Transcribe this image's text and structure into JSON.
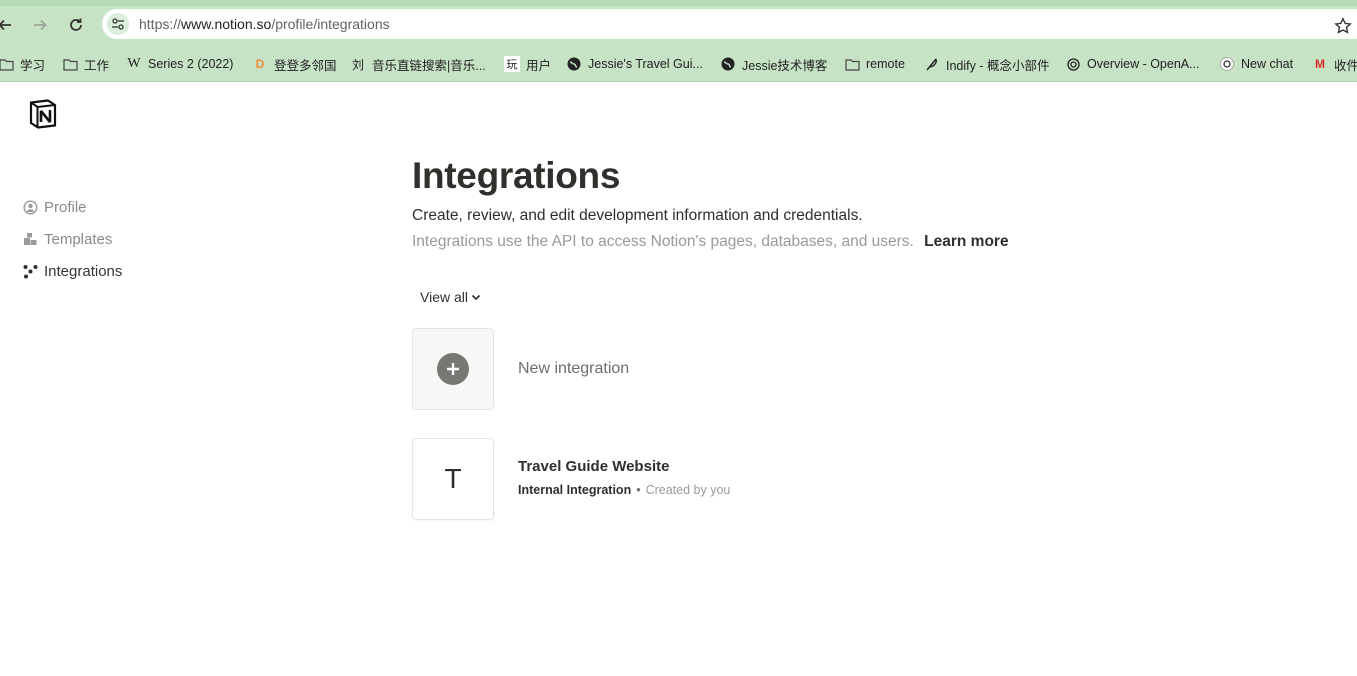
{
  "browser": {
    "url_prefix": "https://",
    "url_host": "www.notion.so",
    "url_path": "/profile/integrations",
    "bookmarks": [
      {
        "label": "学习",
        "icon": "folder-icon"
      },
      {
        "label": "工作",
        "icon": "folder-icon"
      },
      {
        "label": "Series 2 (2022)",
        "icon": "wikipedia-icon",
        "glyph": "W"
      },
      {
        "label": "登登多邻国",
        "icon": "duolingo-icon",
        "glyph": "D"
      },
      {
        "label": "音乐直链搜索|音乐...",
        "icon": "music-search-icon",
        "glyph": "刘"
      },
      {
        "label": "用户",
        "icon": "user-site-icon",
        "glyph": "玩"
      },
      {
        "label": "Jessie's Travel Gui...",
        "icon": "globe-icon"
      },
      {
        "label": "Jessie技术博客",
        "icon": "globe-icon"
      },
      {
        "label": "remote",
        "icon": "folder-icon"
      },
      {
        "label": "Indify - 概念小部件",
        "icon": "feather-icon"
      },
      {
        "label": "Overview - OpenA...",
        "icon": "openai-icon"
      },
      {
        "label": "New chat",
        "icon": "chatgpt-icon"
      },
      {
        "label": "收件",
        "icon": "gmail-icon",
        "glyph": "M"
      }
    ]
  },
  "sidebar": {
    "items": [
      {
        "label": "Profile",
        "icon": "profile-icon",
        "active": false
      },
      {
        "label": "Templates",
        "icon": "templates-icon",
        "active": false
      },
      {
        "label": "Integrations",
        "icon": "integrations-icon",
        "active": true
      }
    ]
  },
  "main": {
    "title": "Integrations",
    "subtitle": "Create, review, and edit development information and credentials.",
    "description": "Integrations use the API to access Notion's pages, databases, and users.",
    "learn_more": "Learn more",
    "filter_label": "View all",
    "new_integration_label": "New integration",
    "integrations": [
      {
        "initial": "T",
        "name": "Travel Guide Website",
        "type": "Internal Integration",
        "separator": "•",
        "creator": "Created by you"
      }
    ]
  },
  "colors": {
    "browser_chrome": "#c7e3c6",
    "text_primary": "#2f2f2c",
    "text_muted": "#9b9a97"
  }
}
